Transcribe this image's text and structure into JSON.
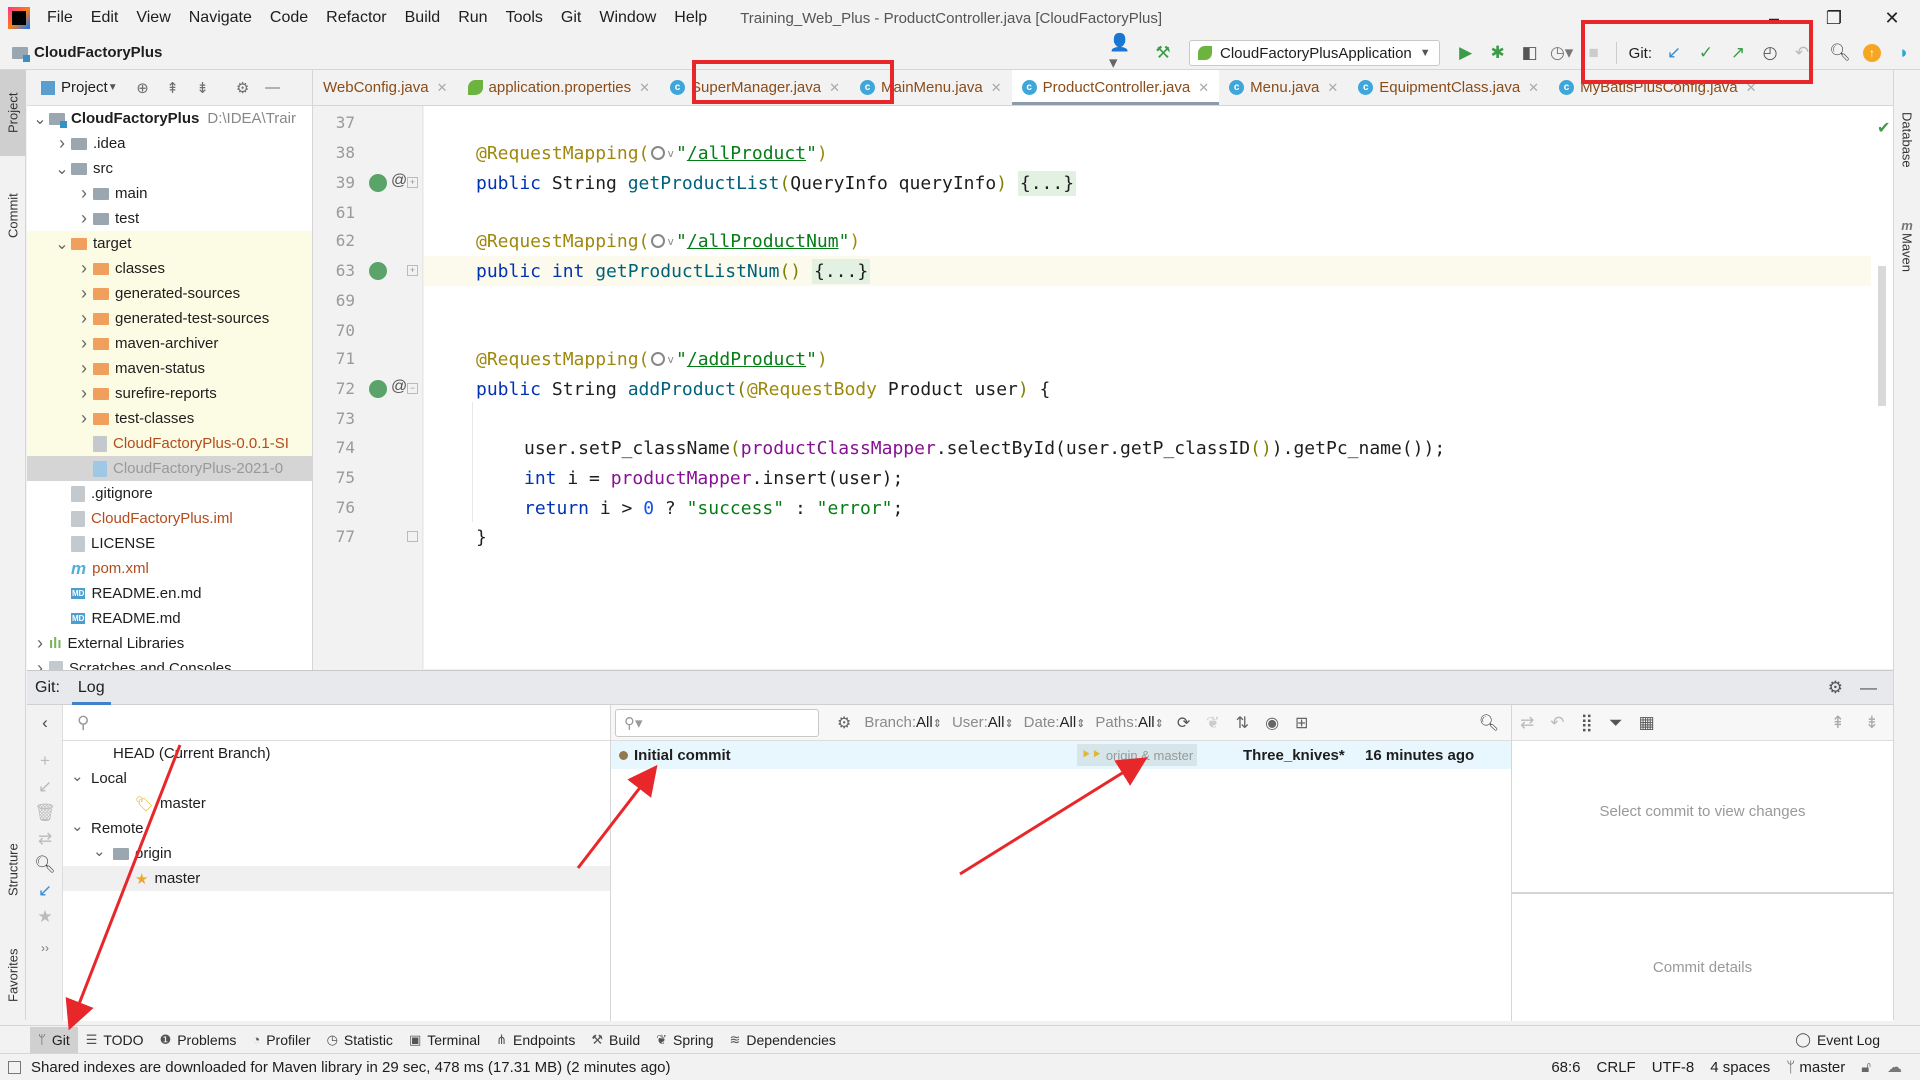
{
  "menu": {
    "items": [
      "File",
      "Edit",
      "View",
      "Navigate",
      "Code",
      "Refactor",
      "Build",
      "Run",
      "Tools",
      "Git",
      "Window",
      "Help"
    ],
    "window_title": "Training_Web_Plus - ProductController.java [CloudFactoryPlus]"
  },
  "window_controls": {
    "minimize": "–",
    "restore": "❐",
    "close": "✕"
  },
  "navbar": {
    "project_name": "CloudFactoryPlus",
    "run_config": "CloudFactoryPlusApplication",
    "git_label": "Git:"
  },
  "project_panel": {
    "title": "Project",
    "tree": [
      {
        "label": "CloudFactoryPlus",
        "suffix": "D:\\IDEA\\Trair",
        "indent": 0,
        "expanded": true,
        "icon": "module-folder",
        "bold": true
      },
      {
        "label": ".idea",
        "indent": 1,
        "expanded": false,
        "icon": "folder"
      },
      {
        "label": "src",
        "indent": 1,
        "expanded": true,
        "icon": "folder"
      },
      {
        "label": "main",
        "indent": 2,
        "expanded": false,
        "icon": "folder"
      },
      {
        "label": "test",
        "indent": 2,
        "expanded": false,
        "icon": "folder"
      },
      {
        "label": "target",
        "indent": 1,
        "expanded": true,
        "icon": "folder-excluded",
        "highlight": true
      },
      {
        "label": "classes",
        "indent": 2,
        "expanded": false,
        "icon": "folder-excluded",
        "highlight": true
      },
      {
        "label": "generated-sources",
        "indent": 2,
        "expanded": false,
        "icon": "folder-excluded",
        "highlight": true
      },
      {
        "label": "generated-test-sources",
        "indent": 2,
        "expanded": false,
        "icon": "folder-excluded",
        "highlight": true
      },
      {
        "label": "maven-archiver",
        "indent": 2,
        "expanded": false,
        "icon": "folder-excluded",
        "highlight": true
      },
      {
        "label": "maven-status",
        "indent": 2,
        "expanded": false,
        "icon": "folder-excluded",
        "highlight": true
      },
      {
        "label": "surefire-reports",
        "indent": 2,
        "expanded": false,
        "icon": "folder-excluded",
        "highlight": true
      },
      {
        "label": "test-classes",
        "indent": 2,
        "expanded": false,
        "icon": "folder-excluded",
        "highlight": true
      },
      {
        "label": "CloudFactoryPlus-0.0.1-SI",
        "indent": 2,
        "icon": "unknown-file",
        "highlight": true,
        "red": true
      },
      {
        "label": "CloudFactoryPlus-2021-0",
        "indent": 2,
        "icon": "archive-file",
        "selected": true,
        "dim": true
      },
      {
        "label": ".gitignore",
        "indent": 1,
        "icon": "ignore-file"
      },
      {
        "label": "CloudFactoryPlus.iml",
        "indent": 1,
        "icon": "iml-file",
        "red": true
      },
      {
        "label": "LICENSE",
        "indent": 1,
        "icon": "text-file"
      },
      {
        "label": "pom.xml",
        "indent": 1,
        "icon": "maven-file",
        "red": true
      },
      {
        "label": "README.en.md",
        "indent": 1,
        "icon": "md-file"
      },
      {
        "label": "README.md",
        "indent": 1,
        "icon": "md-file"
      },
      {
        "label": "External Libraries",
        "indent": 0,
        "expanded": false,
        "icon": "libraries"
      },
      {
        "label": "Scratches and Consoles",
        "indent": 0,
        "expanded": false,
        "icon": "scratches"
      }
    ]
  },
  "editor_tabs": [
    {
      "label": "WebConfig.java",
      "icon": "none"
    },
    {
      "label": "application.properties",
      "icon": "spring"
    },
    {
      "label": "SuperManager.java",
      "icon": "class"
    },
    {
      "label": "MainMenu.java",
      "icon": "class"
    },
    {
      "label": "ProductController.java",
      "icon": "class",
      "active": true
    },
    {
      "label": "Menu.java",
      "icon": "class"
    },
    {
      "label": "EquipmentClass.java",
      "icon": "class"
    },
    {
      "label": "MyBatisPlusConfig.java",
      "icon": "class"
    }
  ],
  "editor": {
    "lines": [
      {
        "num": "37",
        "tokens": []
      },
      {
        "num": "38",
        "tokens": [
          [
            "ann",
            "@RequestMapping("
          ],
          [
            "globe",
            ""
          ],
          [
            "str",
            "\""
          ],
          [
            "url",
            "/allProduct"
          ],
          [
            "str",
            "\""
          ],
          [
            "ann",
            ")"
          ]
        ]
      },
      {
        "num": "39",
        "gutter": [
          "bean",
          "at"
        ],
        "fold": "+",
        "tokens": [
          [
            "kw",
            "public "
          ],
          [
            "txt",
            "String "
          ],
          [
            "fn",
            "getProductList"
          ],
          [
            "paren",
            "("
          ],
          [
            "txt",
            "QueryInfo queryInfo"
          ],
          [
            "paren",
            ")"
          ],
          [
            "txt",
            " "
          ],
          [
            "folded",
            "{...}"
          ]
        ]
      },
      {
        "num": "61",
        "tokens": []
      },
      {
        "num": "62",
        "tokens": [
          [
            "ann",
            "@RequestMapping("
          ],
          [
            "globe",
            ""
          ],
          [
            "str",
            "\""
          ],
          [
            "url",
            "/allProductNum"
          ],
          [
            "str",
            "\""
          ],
          [
            "ann",
            ")"
          ]
        ]
      },
      {
        "num": "63",
        "gutter": [
          "bean"
        ],
        "fold": "+",
        "current": true,
        "tokens": [
          [
            "kw",
            "public int "
          ],
          [
            "fn",
            "getProductListNum"
          ],
          [
            "paren",
            "()"
          ],
          [
            "txt",
            " "
          ],
          [
            "folded",
            "{...}"
          ]
        ]
      },
      {
        "num": "69",
        "tokens": []
      },
      {
        "num": "70",
        "tokens": []
      },
      {
        "num": "71",
        "tokens": [
          [
            "ann",
            "@RequestMapping("
          ],
          [
            "globe",
            ""
          ],
          [
            "str",
            "\""
          ],
          [
            "url",
            "/addProduct"
          ],
          [
            "str",
            "\""
          ],
          [
            "ann",
            ")"
          ]
        ]
      },
      {
        "num": "72",
        "gutter": [
          "bean",
          "at"
        ],
        "fold": "-",
        "tokens": [
          [
            "kw",
            "public "
          ],
          [
            "txt",
            "String "
          ],
          [
            "fn",
            "addProduct"
          ],
          [
            "paren",
            "("
          ],
          [
            "ann",
            "@RequestBody "
          ],
          [
            "txt",
            "Product user"
          ],
          [
            "paren",
            ")"
          ],
          [
            "txt",
            " {"
          ]
        ]
      },
      {
        "num": "73",
        "tokens": []
      },
      {
        "num": "74",
        "indent": 1,
        "tokens": [
          [
            "txt",
            "user.setP_className"
          ],
          [
            "paren",
            "("
          ],
          [
            "fld",
            "productClassMapper"
          ],
          [
            "txt",
            ".selectById(user.getP_classID"
          ],
          [
            "paren",
            "()"
          ],
          [
            "txt",
            ").getPc_name());"
          ]
        ]
      },
      {
        "num": "75",
        "indent": 1,
        "tokens": [
          [
            "kw",
            "int "
          ],
          [
            "txt",
            "i = "
          ],
          [
            "fld",
            "productMapper"
          ],
          [
            "txt",
            ".insert(user);"
          ]
        ]
      },
      {
        "num": "76",
        "indent": 1,
        "tokens": [
          [
            "kw",
            "return "
          ],
          [
            "txt",
            "i > "
          ],
          [
            "num",
            "0"
          ],
          [
            "txt",
            " ? "
          ],
          [
            "str",
            "\"success\""
          ],
          [
            "txt",
            " : "
          ],
          [
            "str",
            "\"error\""
          ],
          [
            "txt",
            ";"
          ]
        ]
      },
      {
        "num": "77",
        "fold": "end",
        "tokens": [
          [
            "txt",
            "}"
          ]
        ]
      }
    ]
  },
  "left_strip": {
    "project": "Project",
    "commit": "Commit",
    "structure": "Structure",
    "favorites": "Favorites"
  },
  "right_strip": {
    "database": "Database",
    "maven": "Maven"
  },
  "git_panel": {
    "prefix": "Git:",
    "tab": "Log",
    "branches": [
      {
        "label": "HEAD (Current Branch)",
        "indent": 1
      },
      {
        "label": "Local",
        "indent": 0,
        "chevron": "v"
      },
      {
        "label": "master",
        "indent": 2,
        "icon": "tag"
      },
      {
        "label": "Remote",
        "indent": 0,
        "chevron": "v"
      },
      {
        "label": "origin",
        "indent": 1,
        "chevron": "v",
        "icon": "folder"
      },
      {
        "label": "master",
        "indent": 2,
        "icon": "star",
        "selected": true
      }
    ],
    "filters": [
      {
        "label": "Branch:",
        "value": "All"
      },
      {
        "label": "User:",
        "value": "All"
      },
      {
        "label": "Date:",
        "value": "All"
      },
      {
        "label": "Paths:",
        "value": "All"
      }
    ],
    "commit": {
      "message": "Initial commit",
      "refs": "origin & master",
      "author": "Three_knives*",
      "date": "16 minutes ago"
    },
    "changes_hint": "Select commit to view changes",
    "details_hint": "Commit details"
  },
  "bottom_tools": [
    {
      "label": "Git",
      "icon": "branch",
      "active": true
    },
    {
      "label": "TODO",
      "icon": "list"
    },
    {
      "label": "Problems",
      "icon": "warning"
    },
    {
      "label": "Profiler",
      "icon": "profiler"
    },
    {
      "label": "Statistic",
      "icon": "pie"
    },
    {
      "label": "Terminal",
      "icon": "terminal"
    },
    {
      "label": "Endpoints",
      "icon": "endpoints"
    },
    {
      "label": "Build",
      "icon": "hammer"
    },
    {
      "label": "Spring",
      "icon": "leaf"
    },
    {
      "label": "Dependencies",
      "icon": "layers"
    }
  ],
  "event_log": "Event Log",
  "status": {
    "message": "Shared indexes are downloaded for Maven library in 29 sec, 478 ms (17.31 MB) (2 minutes ago)",
    "position": "68:6",
    "line_sep": "CRLF",
    "encoding": "UTF-8",
    "indent": "4 spaces",
    "branch": "master"
  },
  "colors": {
    "annotation_red": "#e8272b",
    "accent_blue": "#4083c9",
    "commit_row_bg": "#e8f6fd"
  }
}
